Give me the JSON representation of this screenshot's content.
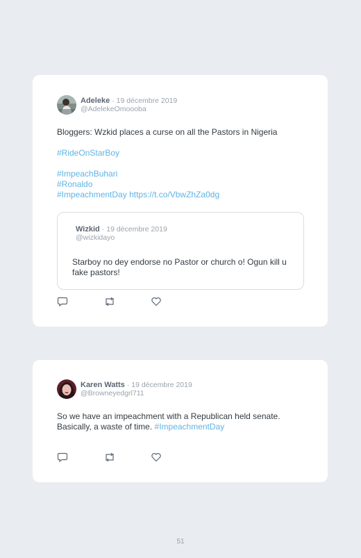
{
  "tweets": [
    {
      "name": "Adeleke",
      "date": "· 19 décembre 2019",
      "handle": "@AdelekeOmoooba",
      "text": "Bloggers: Wzkid places a curse on all the Pastors in Nigeria",
      "lines": [
        "#RideOnStarBoy",
        "#ImpeachBuhari",
        "#Ronaldo",
        "#ImpeachmentDay",
        "https://t.co/VbwZhZa0dg"
      ],
      "quote": {
        "name": "Wizkid",
        "date": "· 19 décembre 2019",
        "handle": "@wizkidayo",
        "text": "Starboy no dey endorse no Pastor or church o! Ogun kill u fake pastors!"
      }
    },
    {
      "name": "Karen Watts",
      "date": "· 19 décembre 2019",
      "handle": "@Browneyedgrl711",
      "text": "So we have an impeachment with a Republican held senate. Basically, a waste of time.",
      "hashtag": "#ImpeachmentDay"
    }
  ],
  "icons": {
    "reply": "reply-icon",
    "retweet": "retweet-icon",
    "like": "heart-icon"
  },
  "colors": {
    "hashtag": "#5fb3e4",
    "background": "#e9ecf0"
  },
  "page_number": "51"
}
